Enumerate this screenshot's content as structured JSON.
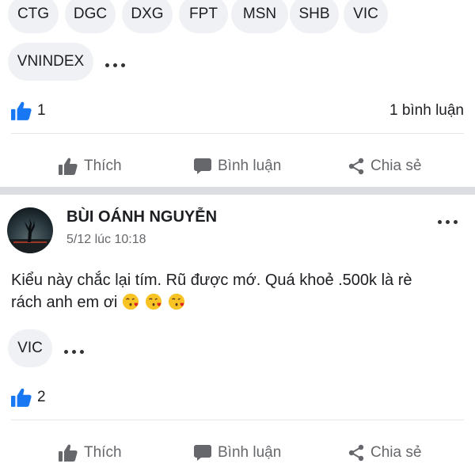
{
  "post1": {
    "tags": [
      "CTG",
      "DGC",
      "DXG",
      "FPT",
      "MSN",
      "SHB",
      "VIC",
      "VNINDEX"
    ],
    "like_count": "1",
    "comment_count": "1 bình luận"
  },
  "actions": {
    "like_label": "Thích",
    "comment_label": "Bình luận",
    "share_label": "Chia sẻ"
  },
  "post2": {
    "author": "BÙI OÁNH NGUYỄN",
    "timestamp": "5/12 lúc 10:18",
    "text_line1": "Kiểu này chắc lại tím. Rũ được mớ. Quá khoẻ .500k là rè",
    "text_line2": "rách anh em ơi",
    "emojis": [
      "kissing-face-icon",
      "kissing-face-icon",
      "kissing-face-icon"
    ],
    "tags": [
      "VIC"
    ],
    "like_count": "2"
  },
  "colors": {
    "accent_blue": "#1877f2",
    "tag_bg": "#eff1f5",
    "muted_text": "#65676b",
    "separator": "#dcdde0"
  }
}
